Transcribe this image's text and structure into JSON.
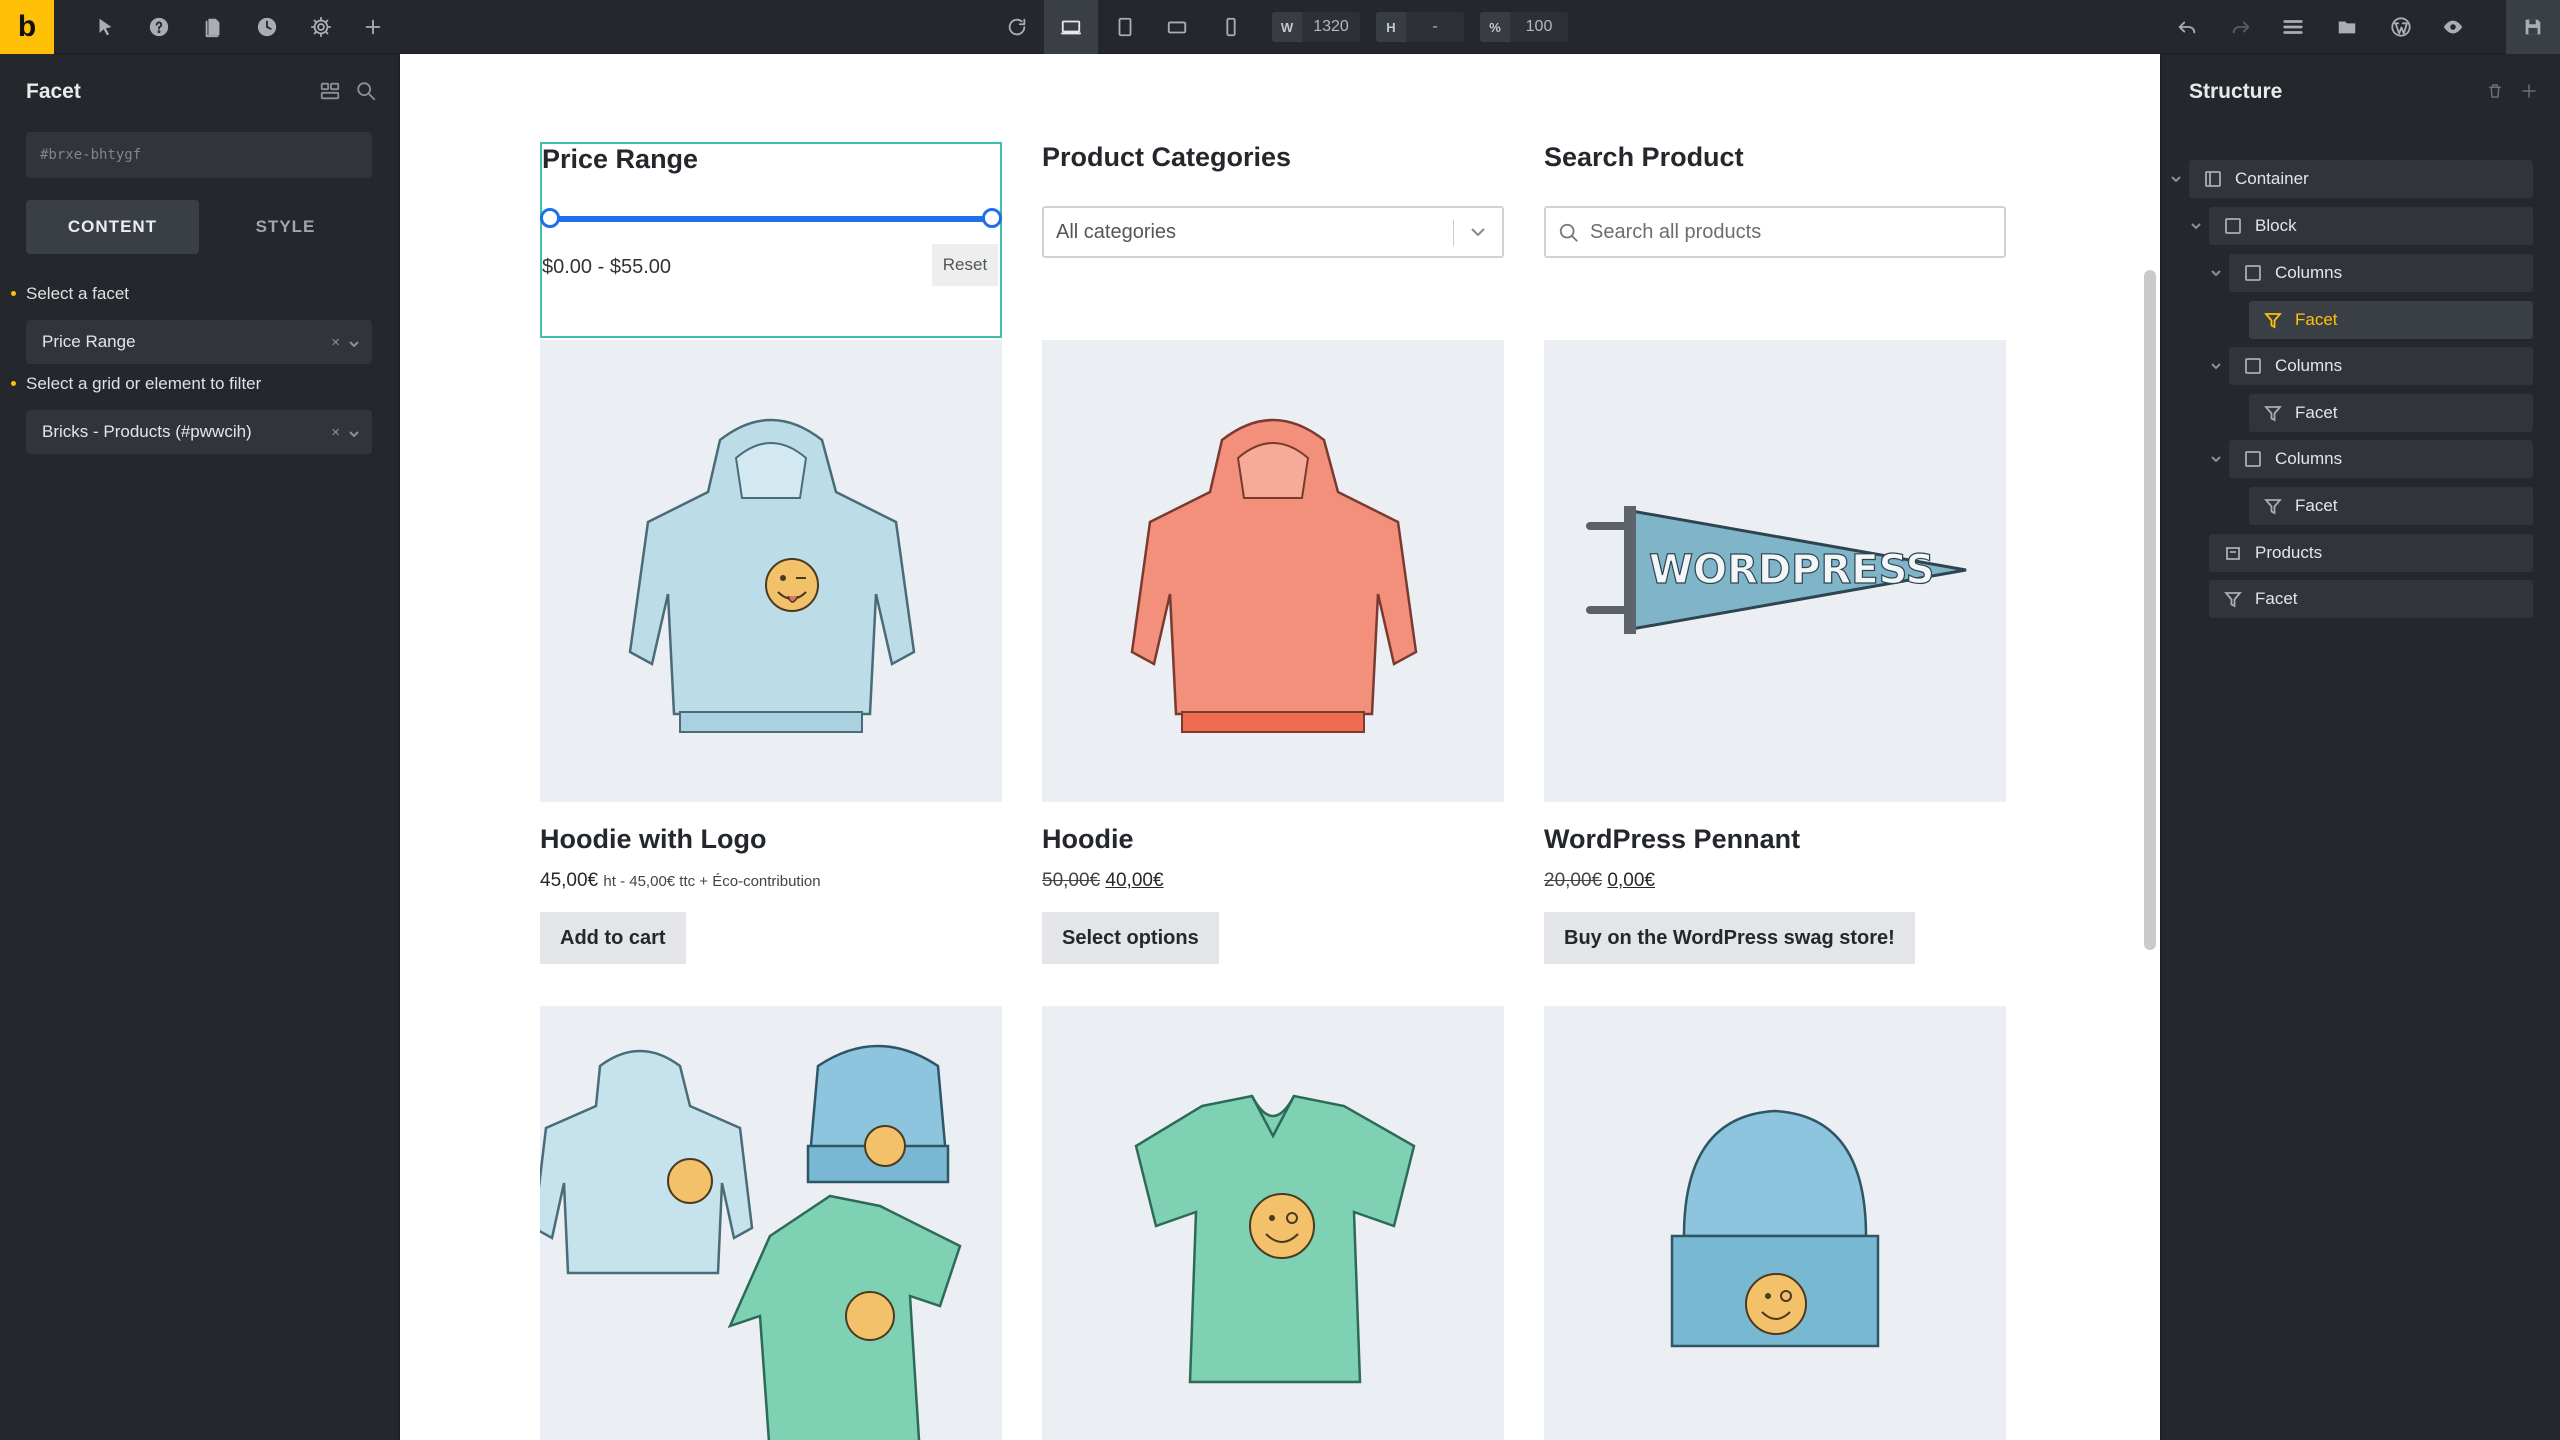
{
  "toolbar": {
    "logo": "b",
    "width_label": "W",
    "width_value": "1320",
    "height_label": "H",
    "height_value": "-",
    "zoom_label": "%",
    "zoom_value": "100"
  },
  "left_panel": {
    "title": "Facet",
    "element_id": "#brxe-bhtygf",
    "tabs": [
      "CONTENT",
      "STYLE"
    ],
    "facet_label": "Select a facet",
    "facet_value": "Price Range",
    "target_label": "Select a grid or element to filter",
    "target_value": "Bricks - Products (#pwwcih)",
    "clear_symbol": "×"
  },
  "canvas": {
    "price_range": {
      "title": "Price Range",
      "value_text": "$0.00 - $55.00",
      "reset_label": "Reset",
      "min_fraction": 0,
      "max_fraction": 1
    },
    "categories": {
      "title": "Product Categories",
      "selected": "All categories"
    },
    "search": {
      "title": "Search Product",
      "placeholder": "Search all products"
    },
    "products": [
      {
        "name": "Hoodie with Logo",
        "price": "45,00€",
        "price_note": "ht - 45,00€ ttc + Éco-contribution",
        "button": "Add to cart",
        "icon": "hoodie-blue-icon"
      },
      {
        "name": "Hoodie",
        "old_price": "50,00€",
        "price": "40,00€",
        "button": "Select options",
        "icon": "hoodie-orange-icon"
      },
      {
        "name": "WordPress Pennant",
        "old_price": "20,00€",
        "price": "0,00€",
        "button": "Buy on the WordPress swag store!",
        "icon": "pennant-icon",
        "pennant_text": "WORDPRESS"
      },
      {
        "icon": "logo-collection-icon"
      },
      {
        "icon": "vneck-tee-icon"
      },
      {
        "icon": "beanie-icon"
      }
    ]
  },
  "structure": {
    "title": "Structure",
    "items": [
      {
        "label": "Container",
        "icon": "container-icon"
      },
      {
        "label": "Block",
        "icon": "block-icon"
      },
      {
        "label": "Columns",
        "icon": "block-icon"
      },
      {
        "label": "Facet",
        "icon": "filter-icon"
      },
      {
        "label": "Columns",
        "icon": "block-icon"
      },
      {
        "label": "Facet",
        "icon": "filter-icon"
      },
      {
        "label": "Columns",
        "icon": "block-icon"
      },
      {
        "label": "Facet",
        "icon": "filter-icon"
      },
      {
        "label": "Products",
        "icon": "products-icon"
      },
      {
        "label": "Facet",
        "icon": "filter-icon"
      }
    ]
  },
  "colors": {
    "accent": "#fec107",
    "slider": "#1e6fe8",
    "selection_outline": "#3fbfae",
    "hoodie_blue": "#bcdde8",
    "hoodie_orange": "#f2907c",
    "tee_green": "#7fd1b4",
    "beanie_blue": "#8cc5dd"
  }
}
